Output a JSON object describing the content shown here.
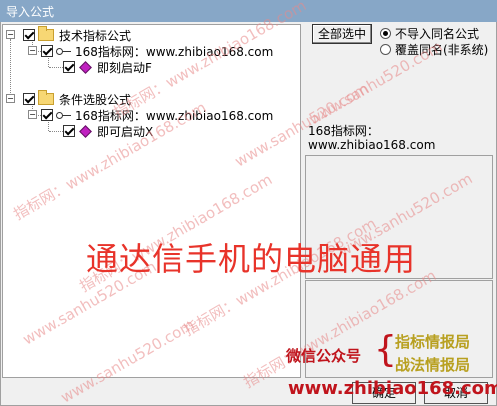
{
  "window": {
    "title": "导入公式"
  },
  "tree": {
    "groups": [
      {
        "label": "技术指标公式",
        "source": "168指标网：www.zhibiao168.com",
        "item": "即刻启动F"
      },
      {
        "label": "条件选股公式",
        "source": "168指标网：www.zhibiao168.com",
        "item": "即可启动X"
      }
    ]
  },
  "controls": {
    "select_all_label": "全部选中",
    "radio_options": [
      "不导入同名公式",
      "覆盖同名(非系统)"
    ],
    "selected_radio_index": 0
  },
  "info": {
    "line1": "168指标网：",
    "line2": "www.zhibiao168.com"
  },
  "overlay": {
    "banner": "通达信手机的电脑通用",
    "wechat_label": "微信公众号",
    "tags": [
      "指标情报局",
      "战法情报局"
    ],
    "url": "www.zhibiao168.com",
    "watermarks": [
      "指标网：www.zhibiao168.com",
      "www.sanhu520.com",
      "指标网：www.zhibiao168.com",
      "www.sanhu520.com",
      "指标网：www.zhibiao168.com",
      "www.sanhu520.com",
      "指标网：www.zhibiao168.com",
      "www.sanhu520.com",
      "指标网：www.zhibiao168.com",
      "www.sanhu520.com"
    ]
  },
  "buttons": {
    "ok_label": "确定",
    "cancel_label": "取消"
  },
  "colors": {
    "titlebar": "#87a7c7",
    "banner_red": "#e8332a",
    "accent_red": "#c0141c",
    "tag_gold": "#b8a020"
  }
}
